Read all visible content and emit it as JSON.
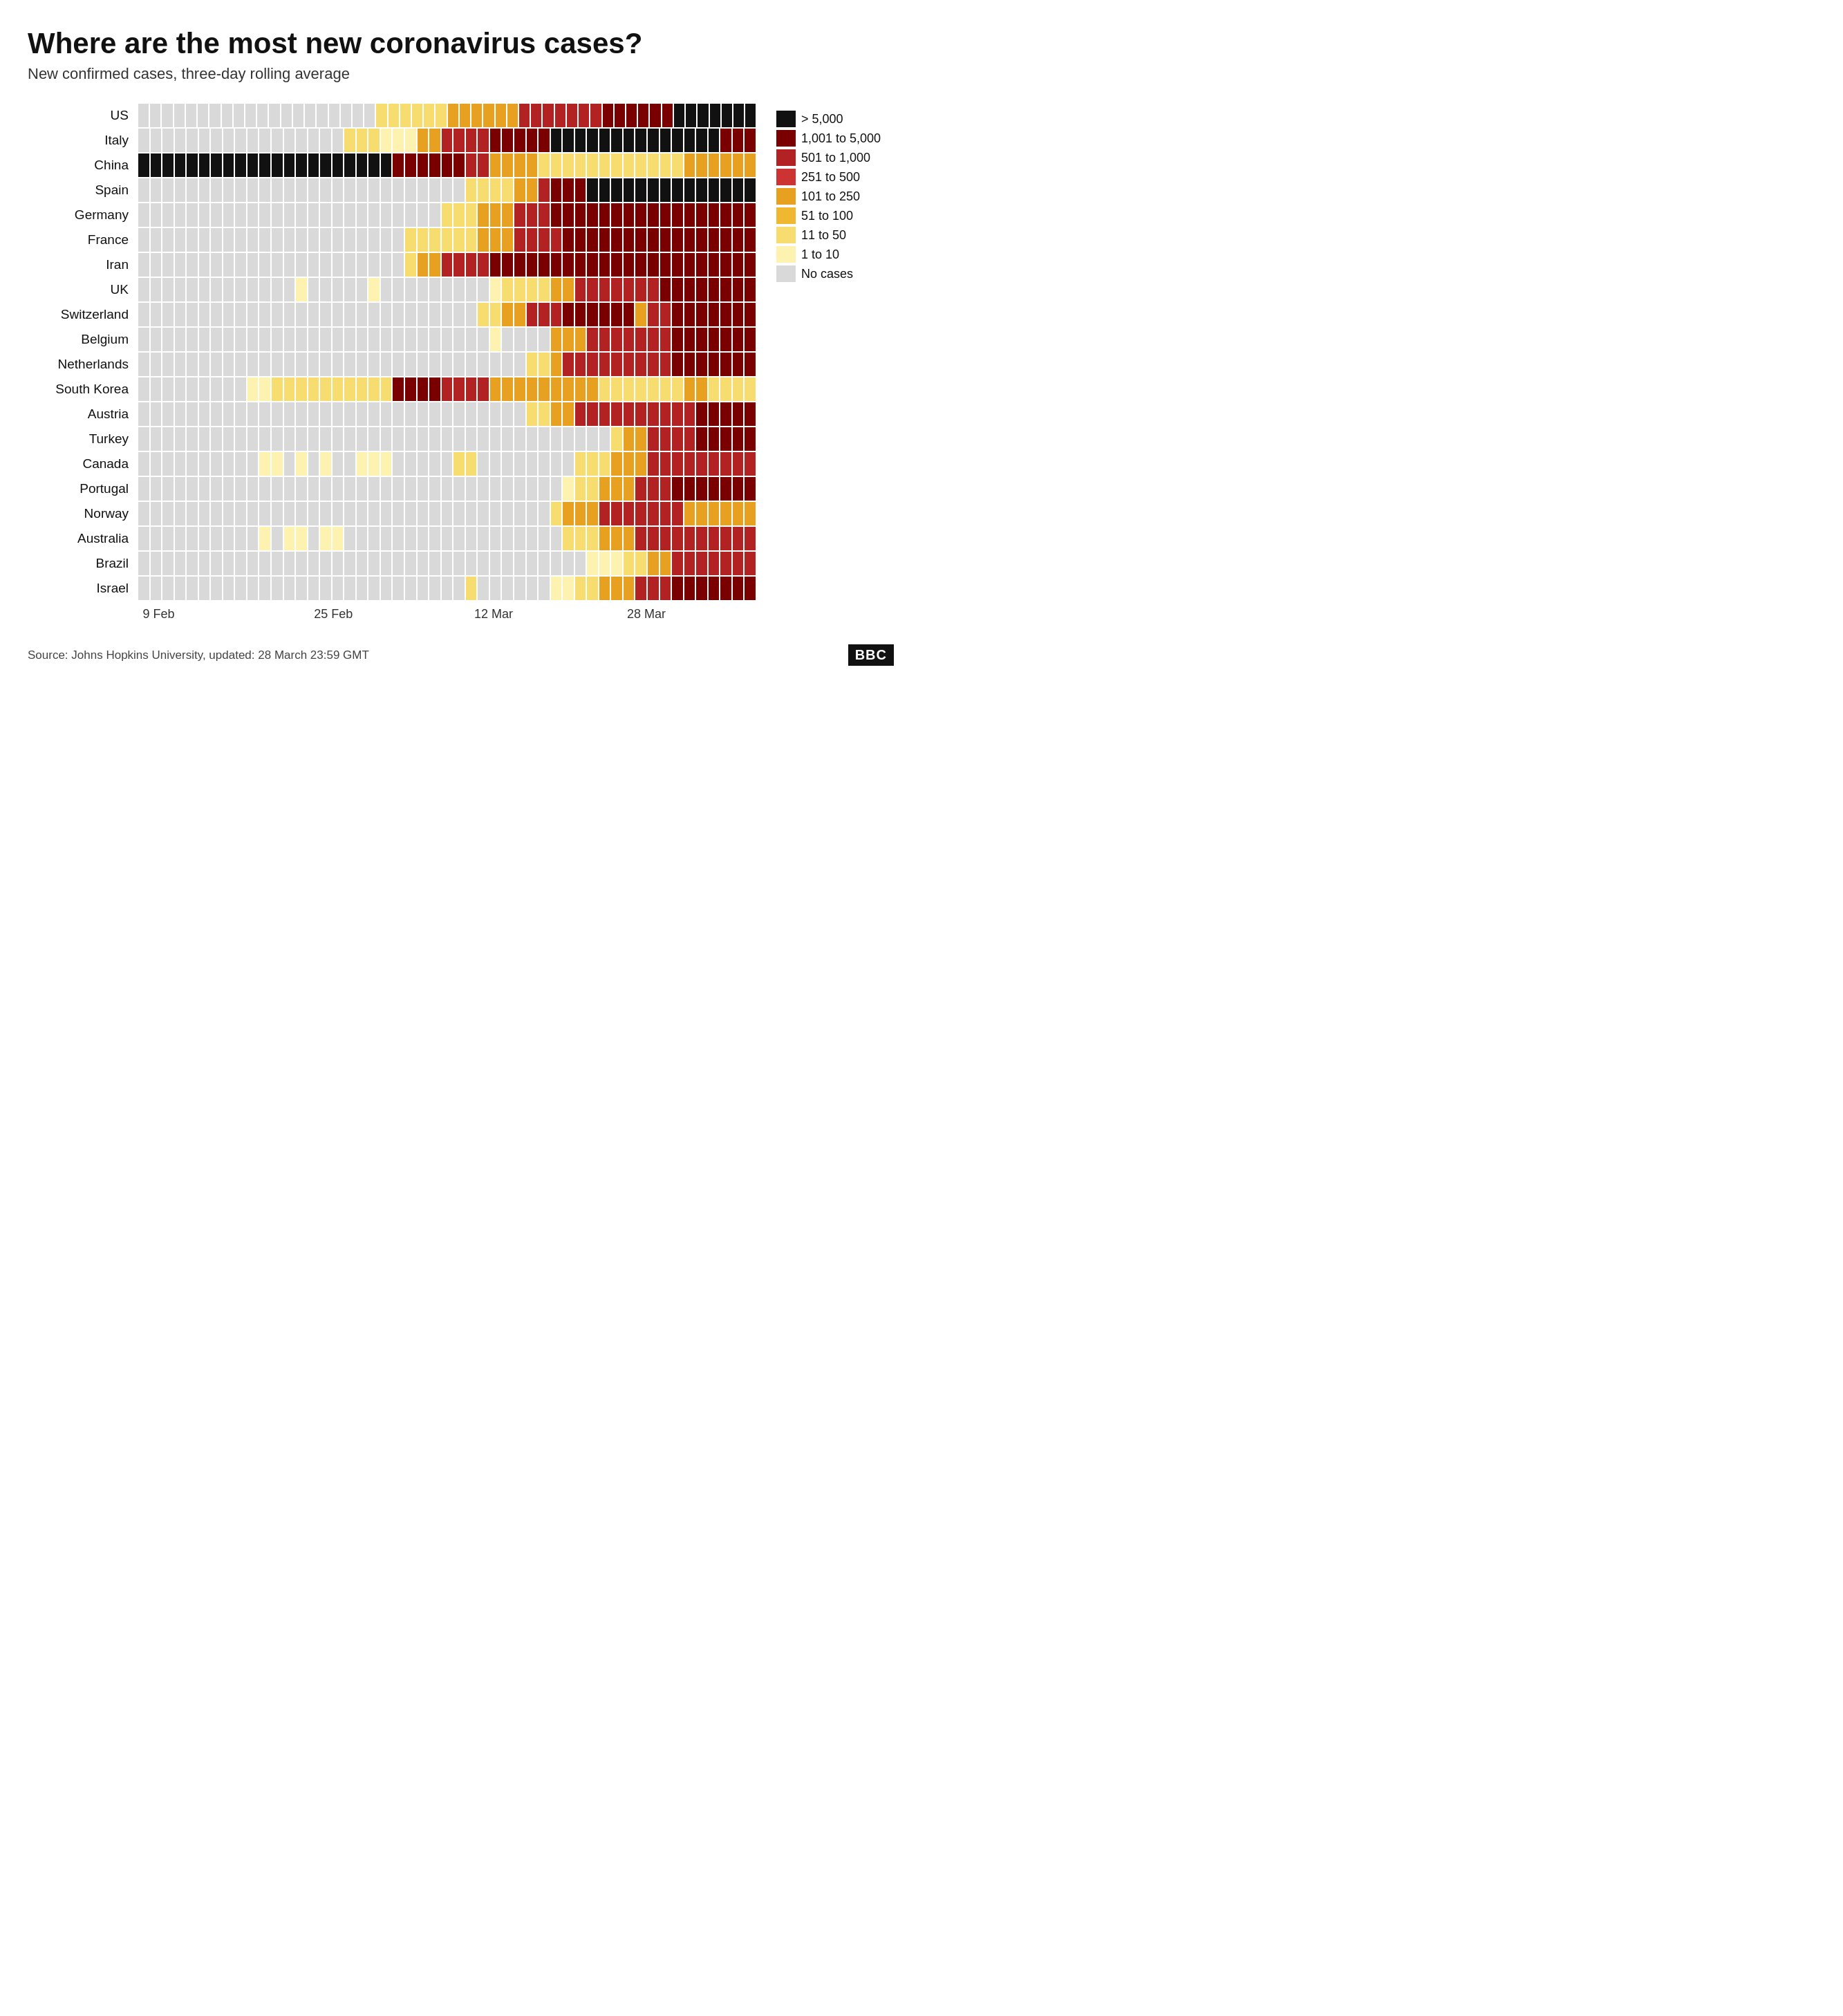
{
  "title": "Where are the most new coronavirus cases?",
  "subtitle": "New confirmed cases, three-day rolling average",
  "colors": {
    "gt5000": "#111111",
    "c1001_5000": "#7a0000",
    "c501_1000": "#b22222",
    "c251_500": "#cc3333",
    "c101_250": "#e8a020",
    "c51_100": "#f0b830",
    "c11_50": "#f7dc6f",
    "c1_10": "#fdf2b0",
    "no_cases": "#d9d9d9"
  },
  "legend": [
    {
      "label": "> 5,000",
      "color_key": "gt5000"
    },
    {
      "label": "1,001 to 5,000",
      "color_key": "c1001_5000"
    },
    {
      "label": "501 to 1,000",
      "color_key": "c501_1000"
    },
    {
      "label": "251 to 500",
      "color_key": "c251_500"
    },
    {
      "label": "101 to 250",
      "color_key": "c101_250"
    },
    {
      "label": "51 to 100",
      "color_key": "c51_100"
    },
    {
      "label": "11 to 50",
      "color_key": "c11_50"
    },
    {
      "label": "1 to 10",
      "color_key": "c1_10"
    },
    {
      "label": "No cases",
      "color_key": "no_cases"
    }
  ],
  "x_labels": [
    {
      "label": "9 Feb",
      "position": 0.18
    },
    {
      "label": "25 Feb",
      "position": 0.42
    },
    {
      "label": "12 Mar",
      "position": 0.64
    },
    {
      "label": "28 Mar",
      "position": 0.85
    }
  ],
  "rows": [
    {
      "country": "US",
      "cells": [
        "N",
        "N",
        "N",
        "N",
        "N",
        "N",
        "N",
        "N",
        "N",
        "N",
        "N",
        "N",
        "N",
        "N",
        "N",
        "N",
        "N",
        "N",
        "N",
        "N",
        "L",
        "L",
        "L",
        "L",
        "L",
        "L",
        "M",
        "M",
        "M",
        "M",
        "M",
        "M",
        "H",
        "H",
        "H",
        "H",
        "H",
        "H",
        "H",
        "VH",
        "VH",
        "VH",
        "VH",
        "VH",
        "VH",
        "MAX",
        "MAX",
        "MAX",
        "MAX",
        "MAX",
        "MAX",
        "MAX"
      ]
    },
    {
      "country": "Italy",
      "cells": [
        "N",
        "N",
        "N",
        "N",
        "N",
        "N",
        "N",
        "N",
        "N",
        "N",
        "N",
        "N",
        "N",
        "N",
        "N",
        "N",
        "N",
        "L",
        "L",
        "L",
        "VL",
        "VL",
        "VL",
        "M",
        "M",
        "H",
        "H",
        "H",
        "H",
        "VH",
        "VH",
        "VH",
        "VH",
        "VH",
        "MAX",
        "MAX",
        "MAX",
        "MAX",
        "MAX",
        "MAX",
        "MAX",
        "MAX",
        "MAX",
        "MAX",
        "MAX",
        "MAX",
        "MAX",
        "MAX",
        "VH",
        "VH",
        "VH"
      ]
    },
    {
      "country": "China",
      "cells": [
        "MAX",
        "MAX",
        "MAX",
        "MAX",
        "MAX",
        "MAX",
        "MAX",
        "MAX",
        "MAX",
        "MAX",
        "MAX",
        "MAX",
        "MAX",
        "MAX",
        "MAX",
        "MAX",
        "MAX",
        "MAX",
        "MAX",
        "MAX",
        "MAX",
        "VH",
        "VH",
        "VH",
        "VH",
        "VH",
        "VH",
        "H",
        "H",
        "M",
        "M",
        "M",
        "M",
        "L",
        "L",
        "L",
        "L",
        "L",
        "L",
        "L",
        "L",
        "L",
        "L",
        "L",
        "L",
        "M",
        "M",
        "M",
        "M",
        "M",
        "M"
      ]
    },
    {
      "country": "Spain",
      "cells": [
        "N",
        "N",
        "N",
        "N",
        "N",
        "N",
        "N",
        "N",
        "N",
        "N",
        "N",
        "N",
        "N",
        "N",
        "N",
        "N",
        "N",
        "N",
        "N",
        "N",
        "N",
        "N",
        "N",
        "N",
        "N",
        "N",
        "N",
        "L",
        "L",
        "L",
        "L",
        "M",
        "M",
        "H",
        "VH",
        "VH",
        "VH",
        "MAX",
        "MAX",
        "MAX",
        "MAX",
        "MAX",
        "MAX",
        "MAX",
        "MAX",
        "MAX",
        "MAX",
        "MAX",
        "MAX",
        "MAX",
        "MAX"
      ]
    },
    {
      "country": "Germany",
      "cells": [
        "N",
        "N",
        "N",
        "N",
        "N",
        "N",
        "N",
        "N",
        "N",
        "N",
        "N",
        "N",
        "N",
        "N",
        "N",
        "N",
        "N",
        "N",
        "N",
        "N",
        "N",
        "N",
        "N",
        "N",
        "N",
        "L",
        "L",
        "L",
        "M",
        "M",
        "M",
        "H",
        "H",
        "H",
        "VH",
        "VH",
        "VH",
        "VH",
        "VH",
        "VH",
        "VH",
        "VH",
        "VH",
        "VH",
        "VH",
        "VH",
        "VH",
        "VH",
        "VH",
        "VH",
        "VH"
      ]
    },
    {
      "country": "France",
      "cells": [
        "N",
        "N",
        "N",
        "N",
        "N",
        "N",
        "N",
        "N",
        "N",
        "N",
        "N",
        "N",
        "N",
        "N",
        "N",
        "N",
        "N",
        "N",
        "N",
        "N",
        "N",
        "N",
        "L",
        "L",
        "L",
        "L",
        "L",
        "L",
        "M",
        "M",
        "M",
        "H",
        "H",
        "H",
        "H",
        "VH",
        "VH",
        "VH",
        "VH",
        "VH",
        "VH",
        "VH",
        "VH",
        "VH",
        "VH",
        "VH",
        "VH",
        "VH",
        "VH",
        "VH",
        "VH"
      ]
    },
    {
      "country": "Iran",
      "cells": [
        "N",
        "N",
        "N",
        "N",
        "N",
        "N",
        "N",
        "N",
        "N",
        "N",
        "N",
        "N",
        "N",
        "N",
        "N",
        "N",
        "N",
        "N",
        "N",
        "N",
        "N",
        "N",
        "L",
        "M",
        "M",
        "H",
        "H",
        "H",
        "H",
        "VH",
        "VH",
        "VH",
        "VH",
        "VH",
        "VH",
        "VH",
        "VH",
        "VH",
        "VH",
        "VH",
        "VH",
        "VH",
        "VH",
        "VH",
        "VH",
        "VH",
        "VH",
        "VH",
        "VH",
        "VH",
        "VH"
      ]
    },
    {
      "country": "UK",
      "cells": [
        "N",
        "N",
        "N",
        "N",
        "N",
        "N",
        "N",
        "N",
        "N",
        "N",
        "N",
        "N",
        "N",
        "VL",
        "N",
        "N",
        "N",
        "N",
        "N",
        "VL",
        "N",
        "N",
        "N",
        "N",
        "N",
        "N",
        "N",
        "N",
        "N",
        "VL",
        "L",
        "L",
        "L",
        "L",
        "M",
        "M",
        "H",
        "H",
        "H",
        "H",
        "H",
        "H",
        "H",
        "VH",
        "VH",
        "VH",
        "VH",
        "VH",
        "VH",
        "VH",
        "VH"
      ]
    },
    {
      "country": "Switzerland",
      "cells": [
        "N",
        "N",
        "N",
        "N",
        "N",
        "N",
        "N",
        "N",
        "N",
        "N",
        "N",
        "N",
        "N",
        "N",
        "N",
        "N",
        "N",
        "N",
        "N",
        "N",
        "N",
        "N",
        "N",
        "N",
        "N",
        "N",
        "N",
        "N",
        "L",
        "L",
        "M",
        "M",
        "H",
        "H",
        "H",
        "VH",
        "VH",
        "VH",
        "VH",
        "VH",
        "VH",
        "M",
        "H",
        "H",
        "VH",
        "VH",
        "VH",
        "VH",
        "VH",
        "VH",
        "VH"
      ]
    },
    {
      "country": "Belgium",
      "cells": [
        "N",
        "N",
        "N",
        "N",
        "N",
        "N",
        "N",
        "N",
        "N",
        "N",
        "N",
        "N",
        "N",
        "N",
        "N",
        "N",
        "N",
        "N",
        "N",
        "N",
        "N",
        "N",
        "N",
        "N",
        "N",
        "N",
        "N",
        "N",
        "N",
        "VL",
        "N",
        "N",
        "N",
        "N",
        "M",
        "M",
        "M",
        "H",
        "H",
        "H",
        "H",
        "H",
        "H",
        "H",
        "VH",
        "VH",
        "VH",
        "VH",
        "VH",
        "VH",
        "VH"
      ]
    },
    {
      "country": "Netherlands",
      "cells": [
        "N",
        "N",
        "N",
        "N",
        "N",
        "N",
        "N",
        "N",
        "N",
        "N",
        "N",
        "N",
        "N",
        "N",
        "N",
        "N",
        "N",
        "N",
        "N",
        "N",
        "N",
        "N",
        "N",
        "N",
        "N",
        "N",
        "N",
        "N",
        "N",
        "N",
        "N",
        "N",
        "L",
        "L",
        "M",
        "H",
        "H",
        "H",
        "H",
        "H",
        "H",
        "H",
        "H",
        "H",
        "VH",
        "VH",
        "VH",
        "VH",
        "VH",
        "VH",
        "VH"
      ]
    },
    {
      "country": "South Korea",
      "cells": [
        "N",
        "N",
        "N",
        "N",
        "N",
        "N",
        "N",
        "N",
        "N",
        "VL",
        "VL",
        "L",
        "L",
        "L",
        "L",
        "L",
        "L",
        "L",
        "L",
        "L",
        "L",
        "VH",
        "VH",
        "VH",
        "VH",
        "H",
        "H",
        "H",
        "H",
        "M",
        "M",
        "M",
        "M",
        "M",
        "M",
        "M",
        "M",
        "M",
        "L",
        "L",
        "L",
        "L",
        "L",
        "L",
        "L",
        "M",
        "M",
        "L",
        "L",
        "L",
        "L"
      ]
    },
    {
      "country": "Austria",
      "cells": [
        "N",
        "N",
        "N",
        "N",
        "N",
        "N",
        "N",
        "N",
        "N",
        "N",
        "N",
        "N",
        "N",
        "N",
        "N",
        "N",
        "N",
        "N",
        "N",
        "N",
        "N",
        "N",
        "N",
        "N",
        "N",
        "N",
        "N",
        "N",
        "N",
        "N",
        "N",
        "N",
        "L",
        "L",
        "M",
        "M",
        "H",
        "H",
        "H",
        "H",
        "H",
        "H",
        "H",
        "H",
        "H",
        "H",
        "VH",
        "VH",
        "VH",
        "VH",
        "VH"
      ]
    },
    {
      "country": "Turkey",
      "cells": [
        "N",
        "N",
        "N",
        "N",
        "N",
        "N",
        "N",
        "N",
        "N",
        "N",
        "N",
        "N",
        "N",
        "N",
        "N",
        "N",
        "N",
        "N",
        "N",
        "N",
        "N",
        "N",
        "N",
        "N",
        "N",
        "N",
        "N",
        "N",
        "N",
        "N",
        "N",
        "N",
        "N",
        "N",
        "N",
        "N",
        "N",
        "N",
        "N",
        "L",
        "M",
        "M",
        "H",
        "H",
        "H",
        "H",
        "VH",
        "VH",
        "VH",
        "VH",
        "VH"
      ]
    },
    {
      "country": "Canada",
      "cells": [
        "N",
        "N",
        "N",
        "N",
        "N",
        "N",
        "N",
        "N",
        "N",
        "N",
        "VL",
        "VL",
        "N",
        "VL",
        "N",
        "VL",
        "N",
        "N",
        "VL",
        "VL",
        "VL",
        "N",
        "N",
        "N",
        "N",
        "N",
        "L",
        "L",
        "N",
        "N",
        "N",
        "N",
        "N",
        "N",
        "N",
        "N",
        "L",
        "L",
        "L",
        "M",
        "M",
        "M",
        "H",
        "H",
        "H",
        "H",
        "H",
        "H",
        "H",
        "H",
        "H"
      ]
    },
    {
      "country": "Portugal",
      "cells": [
        "N",
        "N",
        "N",
        "N",
        "N",
        "N",
        "N",
        "N",
        "N",
        "N",
        "N",
        "N",
        "N",
        "N",
        "N",
        "N",
        "N",
        "N",
        "N",
        "N",
        "N",
        "N",
        "N",
        "N",
        "N",
        "N",
        "N",
        "N",
        "N",
        "N",
        "N",
        "N",
        "N",
        "N",
        "N",
        "VL",
        "L",
        "L",
        "M",
        "M",
        "M",
        "H",
        "H",
        "H",
        "VH",
        "VH",
        "VH",
        "VH",
        "VH",
        "VH",
        "VH"
      ]
    },
    {
      "country": "Norway",
      "cells": [
        "N",
        "N",
        "N",
        "N",
        "N",
        "N",
        "N",
        "N",
        "N",
        "N",
        "N",
        "N",
        "N",
        "N",
        "N",
        "N",
        "N",
        "N",
        "N",
        "N",
        "N",
        "N",
        "N",
        "N",
        "N",
        "N",
        "N",
        "N",
        "N",
        "N",
        "N",
        "N",
        "N",
        "N",
        "L",
        "M",
        "M",
        "M",
        "H",
        "H",
        "H",
        "H",
        "H",
        "H",
        "H",
        "M",
        "M",
        "M",
        "M",
        "M",
        "M"
      ]
    },
    {
      "country": "Australia",
      "cells": [
        "N",
        "N",
        "N",
        "N",
        "N",
        "N",
        "N",
        "N",
        "N",
        "N",
        "VL",
        "N",
        "VL",
        "VL",
        "N",
        "VL",
        "VL",
        "N",
        "N",
        "N",
        "N",
        "N",
        "N",
        "N",
        "N",
        "N",
        "N",
        "N",
        "N",
        "N",
        "N",
        "N",
        "N",
        "N",
        "N",
        "L",
        "L",
        "L",
        "M",
        "M",
        "M",
        "H",
        "H",
        "H",
        "H",
        "H",
        "H",
        "H",
        "H",
        "H",
        "H"
      ]
    },
    {
      "country": "Brazil",
      "cells": [
        "N",
        "N",
        "N",
        "N",
        "N",
        "N",
        "N",
        "N",
        "N",
        "N",
        "N",
        "N",
        "N",
        "N",
        "N",
        "N",
        "N",
        "N",
        "N",
        "N",
        "N",
        "N",
        "N",
        "N",
        "N",
        "N",
        "N",
        "N",
        "N",
        "N",
        "N",
        "N",
        "N",
        "N",
        "N",
        "N",
        "N",
        "VL",
        "VL",
        "VL",
        "L",
        "L",
        "M",
        "M",
        "H",
        "H",
        "H",
        "H",
        "H",
        "H",
        "H"
      ]
    },
    {
      "country": "Israel",
      "cells": [
        "N",
        "N",
        "N",
        "N",
        "N",
        "N",
        "N",
        "N",
        "N",
        "N",
        "N",
        "N",
        "N",
        "N",
        "N",
        "N",
        "N",
        "N",
        "N",
        "N",
        "N",
        "N",
        "N",
        "N",
        "N",
        "N",
        "N",
        "L",
        "N",
        "N",
        "N",
        "N",
        "N",
        "N",
        "VL",
        "VL",
        "L",
        "L",
        "M",
        "M",
        "M",
        "H",
        "H",
        "H",
        "VH",
        "VH",
        "VH",
        "VH",
        "VH",
        "VH",
        "VH"
      ]
    }
  ],
  "footer": {
    "source": "Source: Johns Hopkins University, updated:  28 March 23:59 GMT",
    "logo": "BBC"
  }
}
